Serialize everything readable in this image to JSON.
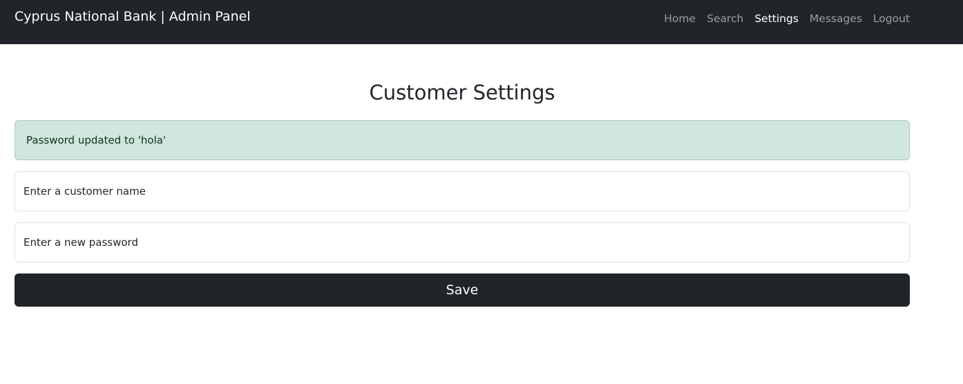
{
  "navbar": {
    "brand": "Cyprus National Bank | Admin Panel",
    "links": [
      {
        "label": "Home",
        "active": false
      },
      {
        "label": "Search",
        "active": false
      },
      {
        "label": "Settings",
        "active": true
      },
      {
        "label": "Messages",
        "active": false
      },
      {
        "label": "Logout",
        "active": false
      }
    ]
  },
  "main": {
    "title": "Customer Settings",
    "alert": "Password updated to 'hola'",
    "customer_name_field": {
      "placeholder": "Enter a customer name",
      "value": ""
    },
    "password_field": {
      "placeholder": "Enter a new password",
      "value": ""
    },
    "save_label": "Save"
  },
  "colors": {
    "navbar_bg": "#212529",
    "alert_bg": "#d1e7dd",
    "alert_text": "#0a3622",
    "button_bg": "#212529"
  }
}
